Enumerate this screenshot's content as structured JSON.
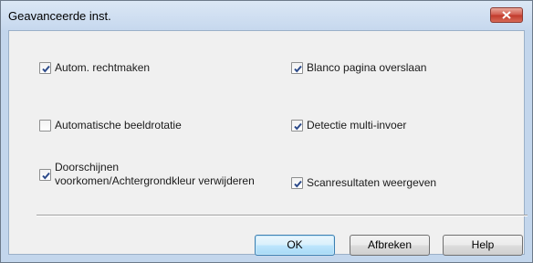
{
  "window": {
    "title": "Geavanceerde inst.",
    "close_icon": "close-icon"
  },
  "options": [
    {
      "label": "Autom. rechtmaken",
      "checked": true
    },
    {
      "label": "Blanco pagina overslaan",
      "checked": true
    },
    {
      "label": "Automatische beeldrotatie",
      "checked": false
    },
    {
      "label": "Detectie multi-invoer",
      "checked": true
    },
    {
      "label": "Doorschijnen voorkomen/Achtergrondkleur verwijderen",
      "checked": true
    },
    {
      "label": "Scanresultaten weergeven",
      "checked": true
    }
  ],
  "buttons": {
    "ok": "OK",
    "cancel": "Afbreken",
    "help": "Help"
  },
  "colors": {
    "titlebar": "#c6d8ee",
    "close": "#c0392b",
    "client": "#f0f0f0",
    "default_button": "#bee6fd"
  }
}
